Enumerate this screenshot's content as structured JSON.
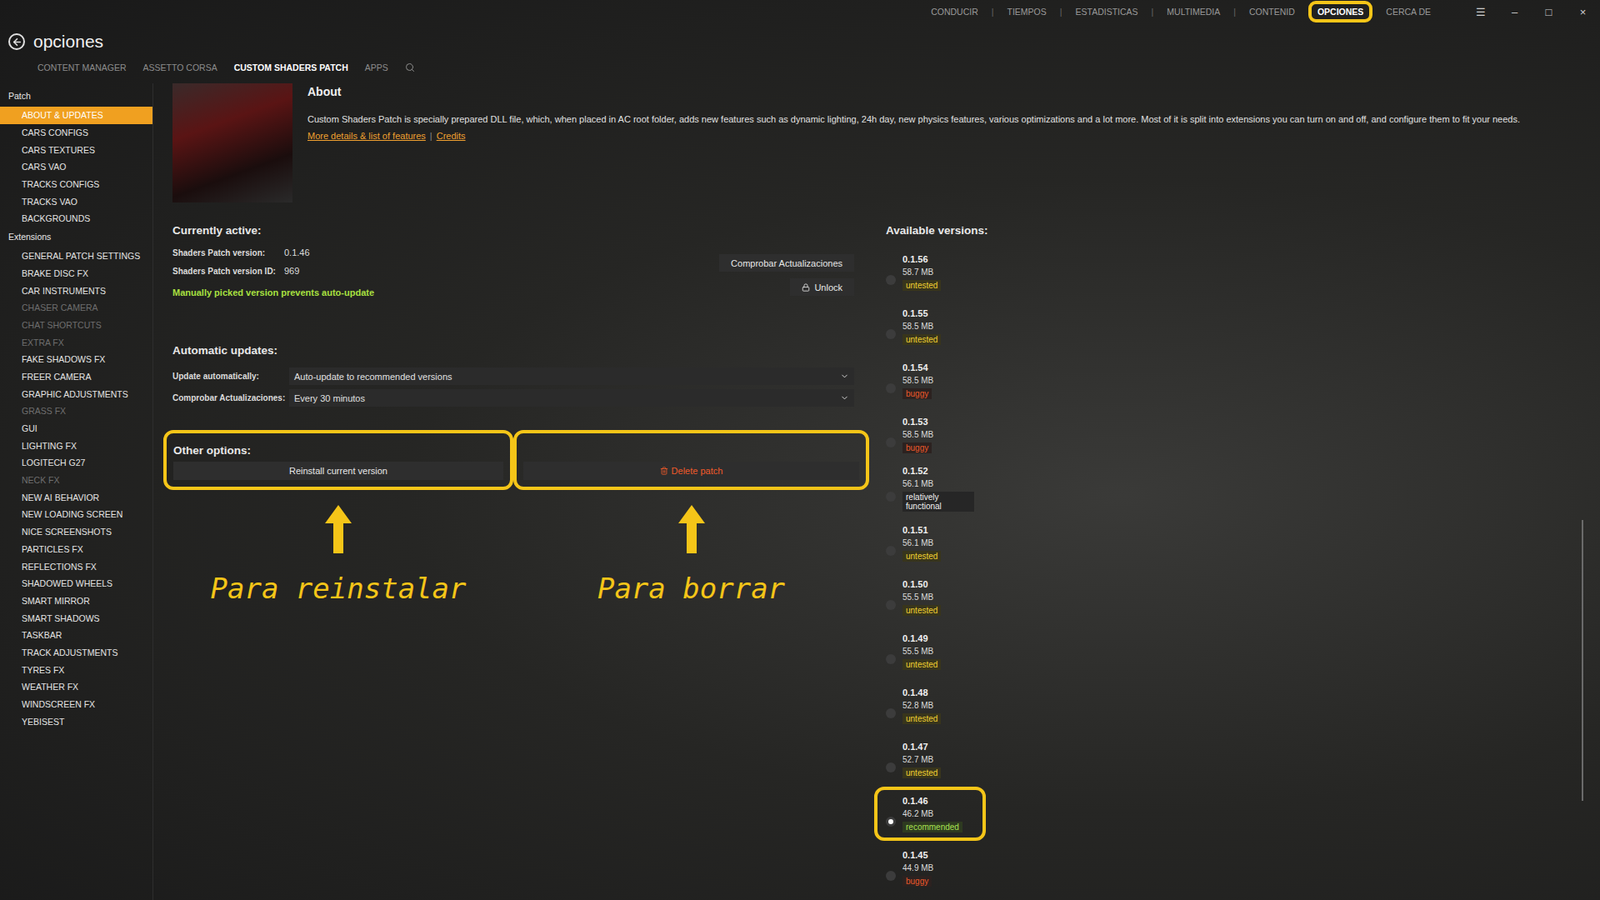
{
  "window": {
    "controls": [
      "☰",
      "–",
      "□",
      "×"
    ]
  },
  "nav": {
    "separator": "|",
    "items": [
      {
        "label": "CONDUCIR",
        "selected": false
      },
      {
        "label": "TIEMPOS",
        "selected": false
      },
      {
        "label": "ESTADISTICAS",
        "selected": false
      },
      {
        "label": "MULTIMEDIA",
        "selected": false
      },
      {
        "label": "CONTENID",
        "selected": false
      },
      {
        "label": "OPCIONES",
        "selected": true
      },
      {
        "label": "CERCA DE",
        "selected": false
      }
    ]
  },
  "page": {
    "title": "opciones"
  },
  "tabs": [
    {
      "label": "CONTENT MANAGER",
      "selected": false
    },
    {
      "label": "ASSETTO CORSA",
      "selected": false
    },
    {
      "label": "CUSTOM SHADERS PATCH",
      "selected": true
    },
    {
      "label": "APPS",
      "selected": false
    }
  ],
  "sidebar": {
    "groups": [
      {
        "title": "Patch",
        "items": [
          {
            "label": "ABOUT & UPDATES",
            "selected": true,
            "disabled": false
          },
          {
            "label": "CARS CONFIGS",
            "selected": false,
            "disabled": false
          },
          {
            "label": "CARS TEXTURES",
            "selected": false,
            "disabled": false
          },
          {
            "label": "CARS VAO",
            "selected": false,
            "disabled": false
          },
          {
            "label": "TRACKS CONFIGS",
            "selected": false,
            "disabled": false
          },
          {
            "label": "TRACKS VAO",
            "selected": false,
            "disabled": false
          },
          {
            "label": "BACKGROUNDS",
            "selected": false,
            "disabled": false
          }
        ]
      },
      {
        "title": "Extensions",
        "items": [
          {
            "label": "GENERAL PATCH SETTINGS",
            "selected": false,
            "disabled": false
          },
          {
            "label": "BRAKE DISC FX",
            "selected": false,
            "disabled": false
          },
          {
            "label": "CAR INSTRUMENTS",
            "selected": false,
            "disabled": false
          },
          {
            "label": "CHASER CAMERA",
            "selected": false,
            "disabled": true
          },
          {
            "label": "CHAT SHORTCUTS",
            "selected": false,
            "disabled": true
          },
          {
            "label": "EXTRA FX",
            "selected": false,
            "disabled": true
          },
          {
            "label": "FAKE SHADOWS FX",
            "selected": false,
            "disabled": false
          },
          {
            "label": "FREER CAMERA",
            "selected": false,
            "disabled": false
          },
          {
            "label": "GRAPHIC ADJUSTMENTS",
            "selected": false,
            "disabled": false
          },
          {
            "label": "GRASS FX",
            "selected": false,
            "disabled": true
          },
          {
            "label": "GUI",
            "selected": false,
            "disabled": false
          },
          {
            "label": "LIGHTING FX",
            "selected": false,
            "disabled": false
          },
          {
            "label": "LOGITECH G27",
            "selected": false,
            "disabled": false
          },
          {
            "label": "NECK FX",
            "selected": false,
            "disabled": true
          },
          {
            "label": "NEW AI BEHAVIOR",
            "selected": false,
            "disabled": false
          },
          {
            "label": "NEW LOADING SCREEN",
            "selected": false,
            "disabled": false
          },
          {
            "label": "NICE SCREENSHOTS",
            "selected": false,
            "disabled": false
          },
          {
            "label": "PARTICLES FX",
            "selected": false,
            "disabled": false
          },
          {
            "label": "REFLECTIONS FX",
            "selected": false,
            "disabled": false
          },
          {
            "label": "SHADOWED WHEELS",
            "selected": false,
            "disabled": false
          },
          {
            "label": "SMART MIRROR",
            "selected": false,
            "disabled": false
          },
          {
            "label": "SMART SHADOWS",
            "selected": false,
            "disabled": false
          },
          {
            "label": "TASKBAR",
            "selected": false,
            "disabled": false
          },
          {
            "label": "TRACK ADJUSTMENTS",
            "selected": false,
            "disabled": false
          },
          {
            "label": "TYRES FX",
            "selected": false,
            "disabled": false
          },
          {
            "label": "WEATHER FX",
            "selected": false,
            "disabled": false
          },
          {
            "label": "WINDSCREEN FX",
            "selected": false,
            "disabled": false
          },
          {
            "label": "YEBISEST",
            "selected": false,
            "disabled": false
          }
        ]
      }
    ]
  },
  "about": {
    "title": "About",
    "description": "Custom Shaders Patch is specially prepared DLL file, which, when placed in AC root folder, adds new features such as dynamic lighting, 24h day, new physics features, various optimizations and a lot more. Most of it is split into extensions you can turn on and off, and configure them to fit your needs.",
    "separator": "|",
    "links": [
      "More details & list of features",
      "Credits"
    ]
  },
  "current": {
    "title": "Currently active:",
    "fields": [
      {
        "label": "Shaders Patch version:",
        "value": "0.1.46"
      },
      {
        "label": "Shaders Patch version ID:",
        "value": "969"
      }
    ],
    "notice": "Manually picked version prevents auto-update",
    "check_button": "Comprobar Actualizaciones",
    "unlock_button": "Unlock"
  },
  "auto_updates": {
    "title": "Automatic updates:",
    "fields": [
      {
        "label": "Update automatically:",
        "value": "Auto-update to recommended versions"
      },
      {
        "label": "Comprobar Actualizaciones:",
        "value": "Every 30 minutos"
      }
    ]
  },
  "other_options": {
    "title": "Other options:",
    "buttons": [
      {
        "label": "Reinstall current version",
        "kind": "normal",
        "annotation": "Para reinstalar"
      },
      {
        "label": "Delete patch",
        "kind": "danger",
        "annotation": "Para borrar"
      }
    ]
  },
  "versions": {
    "title": "Available versions:",
    "items": [
      {
        "version": "0.1.56",
        "size": "58.7 MB",
        "status": "untested",
        "kind": "untested",
        "selected": false
      },
      {
        "version": "0.1.55",
        "size": "58.5 MB",
        "status": "untested",
        "kind": "untested",
        "selected": false
      },
      {
        "version": "0.1.54",
        "size": "58.5 MB",
        "status": "buggy",
        "kind": "buggy",
        "selected": false
      },
      {
        "version": "0.1.53",
        "size": "58.5 MB",
        "status": "buggy",
        "kind": "buggy",
        "selected": false
      },
      {
        "version": "0.1.52",
        "size": "56.1 MB",
        "status": "relatively functional",
        "kind": "functional",
        "selected": false
      },
      {
        "version": "0.1.51",
        "size": "56.1 MB",
        "status": "untested",
        "kind": "untested",
        "selected": false
      },
      {
        "version": "0.1.50",
        "size": "55.5 MB",
        "status": "untested",
        "kind": "untested",
        "selected": false
      },
      {
        "version": "0.1.49",
        "size": "55.5 MB",
        "status": "untested",
        "kind": "untested",
        "selected": false
      },
      {
        "version": "0.1.48",
        "size": "52.8 MB",
        "status": "untested",
        "kind": "untested",
        "selected": false
      },
      {
        "version": "0.1.47",
        "size": "52.7 MB",
        "status": "untested",
        "kind": "untested",
        "selected": false
      },
      {
        "version": "0.1.46",
        "size": "46.2 MB",
        "status": "recommended",
        "kind": "recommended",
        "selected": true
      },
      {
        "version": "0.1.45",
        "size": "44.9 MB",
        "status": "buggy",
        "kind": "buggy",
        "selected": false
      }
    ]
  }
}
